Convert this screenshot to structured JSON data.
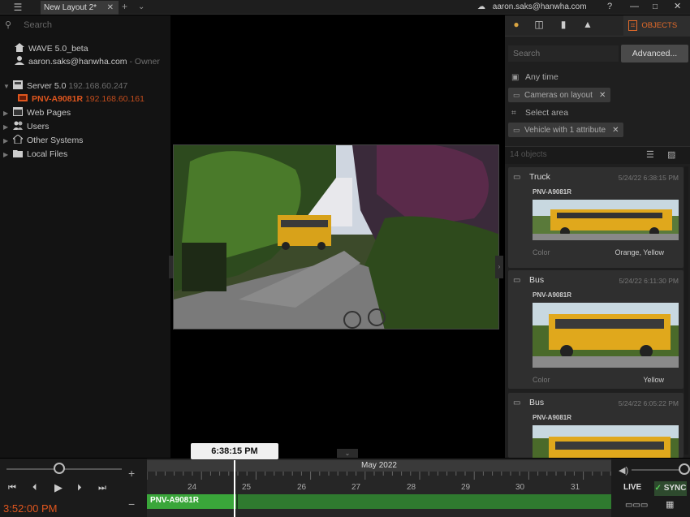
{
  "titlebar": {
    "tab_label": "New Layout 2*",
    "tab_close": "✕",
    "new_tab": "+",
    "user_email": "aaron.saks@hanwha.com",
    "help": "?",
    "minimize": "—",
    "maximize": "□",
    "close": "✕"
  },
  "left_panel": {
    "search_placeholder": "Search",
    "tree": [
      {
        "label": "WAVE 5.0_beta",
        "extra": ""
      },
      {
        "label": "aaron.saks@hanwha.com",
        "extra": "- Owner"
      },
      {
        "label": "Server 5.0",
        "extra": "192.168.60.247"
      },
      {
        "label": "PNV-A9081R",
        "extra": "192.168.60.161"
      },
      {
        "label": "Web Pages",
        "extra": ""
      },
      {
        "label": "Users",
        "extra": ""
      },
      {
        "label": "Other Systems",
        "extra": ""
      },
      {
        "label": "Local Files",
        "extra": ""
      }
    ]
  },
  "right_panel": {
    "objects_tab": "OBJECTS",
    "search_placeholder": "Search",
    "advanced_button": "Advanced...",
    "filters": {
      "time": "Any time",
      "cameras": "Cameras on layout",
      "area": "Select area",
      "vehicle": "Vehicle with 1 attribute"
    },
    "count_text": "14 objects",
    "cards": [
      {
        "type": "Truck",
        "time": "5/24/22 6:38:15 PM",
        "camera": "PNV-A9081R",
        "attr_name": "Color",
        "attr_value": "Orange, Yellow"
      },
      {
        "type": "Bus",
        "time": "5/24/22 6:11:30 PM",
        "camera": "PNV-A9081R",
        "attr_name": "Color",
        "attr_value": "Yellow"
      },
      {
        "type": "Bus",
        "time": "5/24/22 6:05:22 PM",
        "camera": "PNV-A9081R",
        "attr_name": "",
        "attr_value": ""
      }
    ]
  },
  "timeline": {
    "current_time_popup": "6:38:15 PM",
    "month": "May 2022",
    "days": [
      "24",
      "25",
      "26",
      "27",
      "28",
      "29",
      "30",
      "31"
    ],
    "camera_label": "PNV-A9081R",
    "clock": "3:52:00 PM",
    "live_label": "LIVE",
    "sync_label": "SYNC"
  },
  "icons": {
    "menu": "menu-icon",
    "user": "user-icon",
    "server": "server-icon",
    "camera": "camera-icon"
  },
  "colors": {
    "accent_orange": "#e56b2a",
    "camera_red": "#e0561e",
    "timeline_green": "#3aa63a"
  }
}
